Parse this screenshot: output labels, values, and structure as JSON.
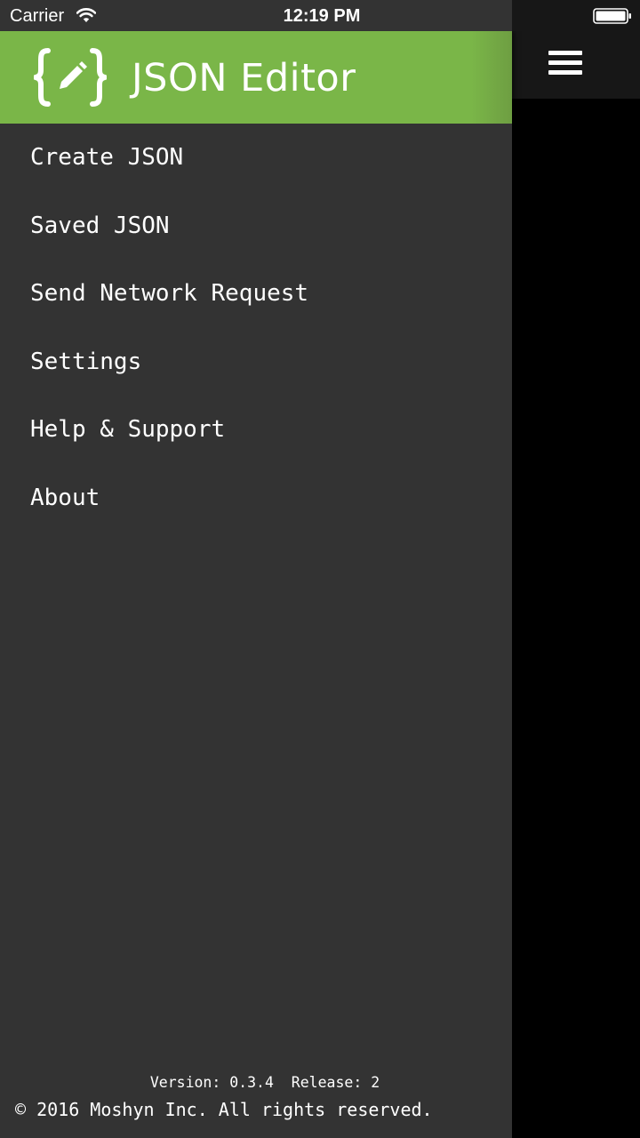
{
  "status_bar": {
    "carrier": "Carrier",
    "time": "12:19 PM",
    "wifi_icon": "wifi-icon",
    "battery_icon": "battery-icon"
  },
  "drawer": {
    "header": {
      "app_title": "JSON Editor",
      "logo_icon": "json-editor-logo-icon",
      "background_color": "#7ab648"
    },
    "items": [
      {
        "label": "Create JSON"
      },
      {
        "label": "Saved JSON"
      },
      {
        "label": "Send Network Request"
      },
      {
        "label": "Settings"
      },
      {
        "label": "Help & Support"
      },
      {
        "label": "About"
      }
    ],
    "footer": {
      "version_label": "Version:",
      "version_value": "0.3.4",
      "release_label": "Release:",
      "release_value": "2",
      "copyright": "© 2016 Moshyn Inc. All rights reserved."
    },
    "background_color": "#333333"
  },
  "main": {
    "menu_icon": "hamburger-menu-icon",
    "nav_color": "#171717"
  }
}
